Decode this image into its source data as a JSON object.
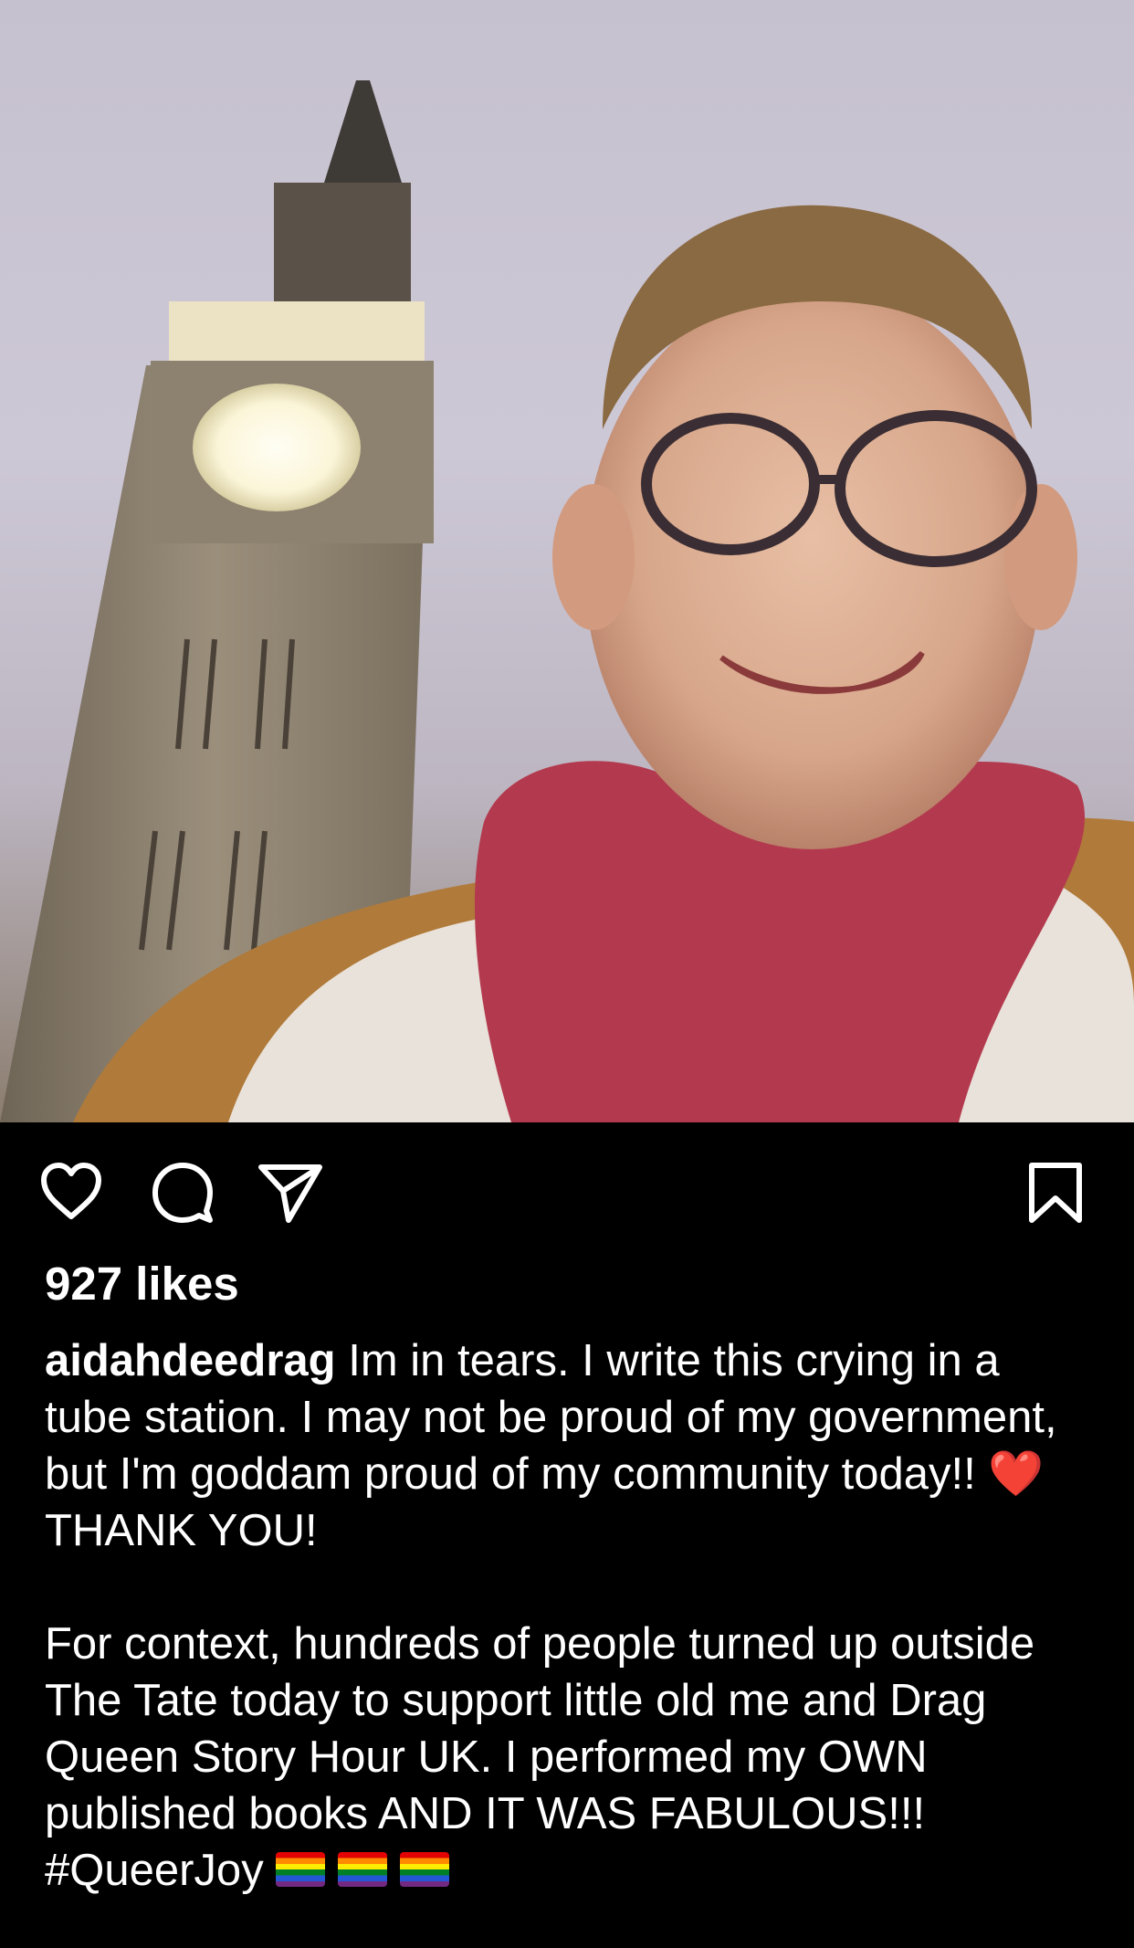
{
  "post": {
    "photo": {
      "description_icon": "selfie-photo",
      "sky_color": "#c8c3d0"
    },
    "actions": {
      "like_icon": "heart-icon",
      "comment_icon": "comment-icon",
      "share_icon": "paper-plane-icon",
      "save_icon": "bookmark-icon"
    },
    "likes_text": "927 likes",
    "caption": {
      "username": "aidahdeedrag",
      "paragraph1_a": " Im in tears. I write this crying in a tube station. I may not be proud of my government, but I'm goddam proud of my community today!! ",
      "emoji_heart": "❤️",
      "paragraph1_b": " THANK YOU!",
      "paragraph2": "For context, hundreds of people turned up outside The Tate today to support little old me and Drag Queen Story Hour UK. I performed my OWN published books AND IT WAS FABULOUS!!! #QueerJoy "
    }
  }
}
